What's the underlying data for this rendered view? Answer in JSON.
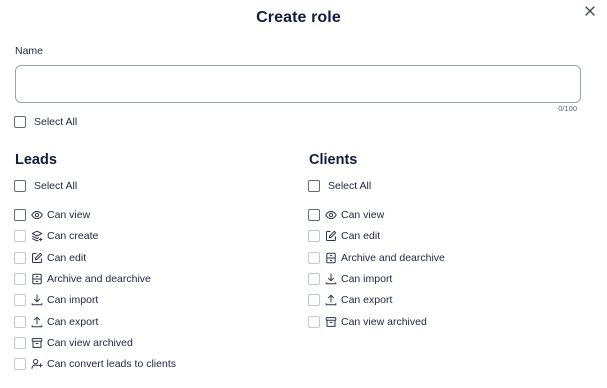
{
  "dialog": {
    "title": "Create role",
    "close_icon": "close-icon"
  },
  "name_field": {
    "label": "Name",
    "value": "",
    "placeholder": "",
    "counter": "0/100"
  },
  "global_select_all": {
    "label": "Select All",
    "checked": false
  },
  "leads": {
    "title": "Leads",
    "select_all": "Select All",
    "permissions": [
      {
        "label": "Can view",
        "icon": "eye-icon",
        "checked": false
      },
      {
        "label": "Can create",
        "icon": "layers-plus-icon",
        "checked": false
      },
      {
        "label": "Can edit",
        "icon": "edit-icon",
        "checked": false
      },
      {
        "label": "Archive and dearchive",
        "icon": "archive-box-icon",
        "checked": false
      },
      {
        "label": "Can import",
        "icon": "download-icon",
        "checked": false
      },
      {
        "label": "Can export",
        "icon": "upload-icon",
        "checked": false
      },
      {
        "label": "Can view archived",
        "icon": "archive-icon",
        "checked": false
      },
      {
        "label": "Can convert leads to clients",
        "icon": "user-convert-icon",
        "checked": false
      }
    ]
  },
  "clients": {
    "title": "Clients",
    "select_all": "Select All",
    "permissions": [
      {
        "label": "Can view",
        "icon": "eye-icon",
        "checked": false
      },
      {
        "label": "Can edit",
        "icon": "edit-icon",
        "checked": false
      },
      {
        "label": "Archive and dearchive",
        "icon": "archive-box-icon",
        "checked": false
      },
      {
        "label": "Can import",
        "icon": "download-icon",
        "checked": false
      },
      {
        "label": "Can export",
        "icon": "upload-icon",
        "checked": false
      },
      {
        "label": "Can view archived",
        "icon": "archive-icon",
        "checked": false
      }
    ]
  },
  "colors": {
    "heading": "#121c3b",
    "text": "#1c2541",
    "checkbox_border": "#636a7a",
    "checkbox_border_light": "#c3c7d0",
    "input_border": "#9aa1b1"
  }
}
